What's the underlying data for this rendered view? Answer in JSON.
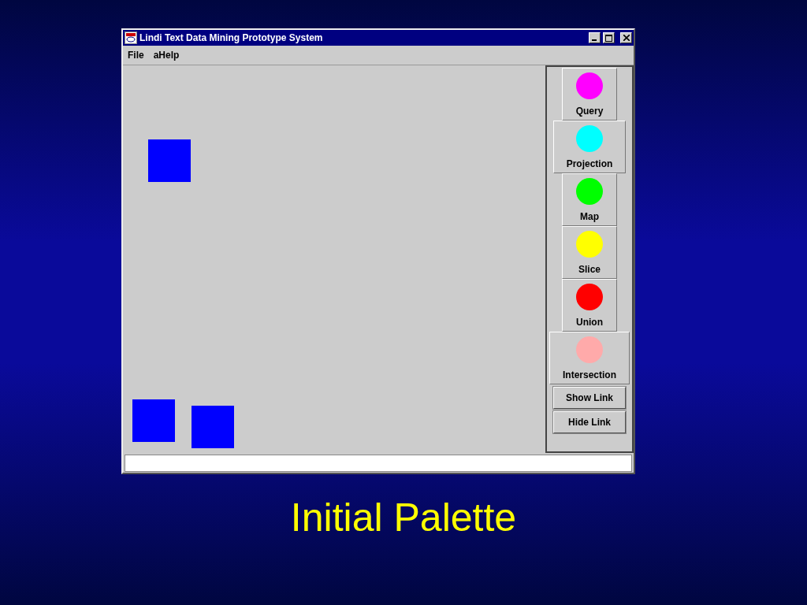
{
  "window": {
    "title": "Lindi Text Data Mining Prototype System"
  },
  "menu": [
    "File",
    "aHelp"
  ],
  "palette": [
    {
      "label": "Query",
      "color": "#ff00ff"
    },
    {
      "label": "Projection",
      "color": "#00ffff"
    },
    {
      "label": "Map",
      "color": "#00ff00"
    },
    {
      "label": "Slice",
      "color": "#ffff00"
    },
    {
      "label": "Union",
      "color": "#ff0000"
    },
    {
      "label": "Intersection",
      "color": "#ffaaaa"
    }
  ],
  "link_buttons": [
    "Show Link",
    "Hide Link"
  ],
  "caption": "Initial Palette"
}
